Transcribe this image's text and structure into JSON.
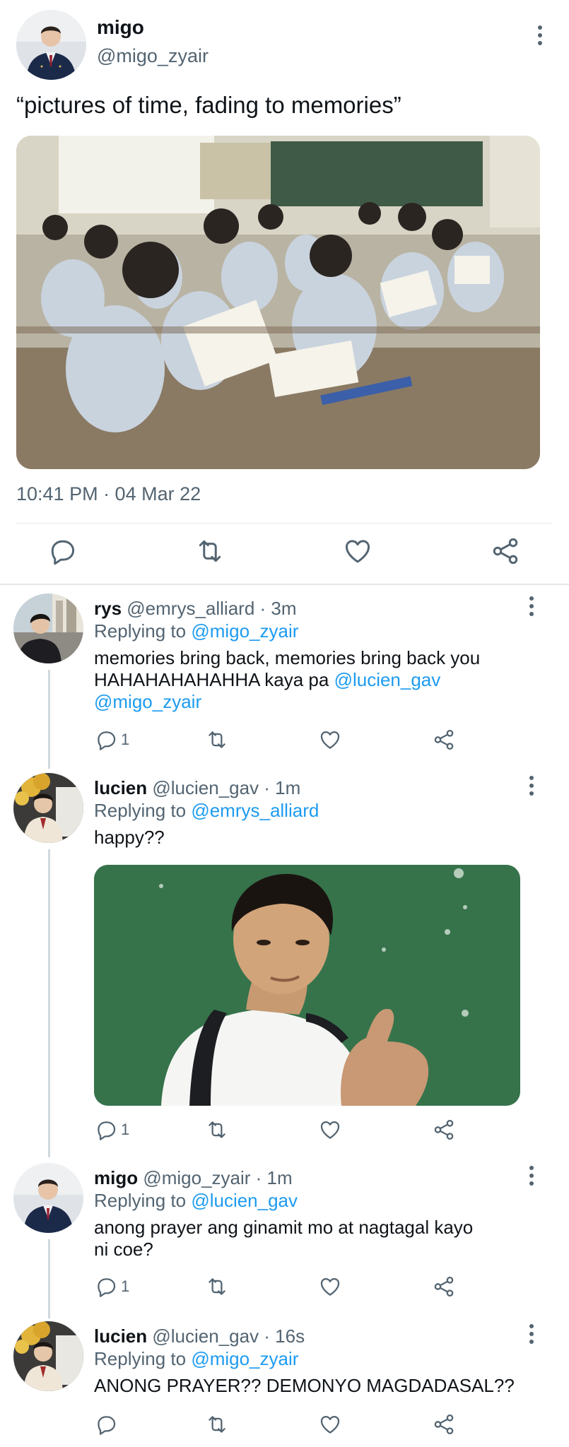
{
  "main_tweet": {
    "name": "migo",
    "handle": "@migo_zyair",
    "text": "“pictures of time, fading to memories”",
    "timestamp": "10:41 PM · 04 Mar 22",
    "image_icon": "classroom-photo",
    "actions": [
      "reply-icon",
      "retweet-icon",
      "like-icon",
      "share-icon"
    ]
  },
  "replies": [
    {
      "name": "rys",
      "meta": "@emrys_alliard · 3m",
      "replying_label": "Replying to",
      "replying_to": "@migo_zyair",
      "text_line1": "memories bring back, memories bring back you",
      "text_line2a": "HAHAHAHAHAHHA kaya pa ",
      "text_line2b": "@lucien_gav",
      "text_line3": "@migo_zyair",
      "reply_count": "1"
    },
    {
      "name": "lucien",
      "meta": "@lucien_gav · 1m",
      "replying_label": "Replying to",
      "replying_to": "@emrys_alliard",
      "text": "happy??",
      "image_icon": "thumbs-up-photo",
      "reply_count": "1"
    },
    {
      "name": "migo",
      "meta": "@migo_zyair · 1m",
      "replying_label": "Replying to",
      "replying_to": "@lucien_gav",
      "text": "anong prayer ang ginamit mo at nagtagal kayo ni coe?",
      "reply_count": "1"
    },
    {
      "name": "lucien",
      "meta": "@lucien_gav · 16s",
      "replying_label": "Replying to",
      "replying_to": "@migo_zyair",
      "text": "ANONG PRAYER?? DEMONYO MAGDADASAL??",
      "reply_count": ""
    }
  ],
  "colors": {
    "link": "#1d9bf0",
    "secondary": "#536471",
    "primary": "#0f1419",
    "divider": "#e4e8eb"
  }
}
